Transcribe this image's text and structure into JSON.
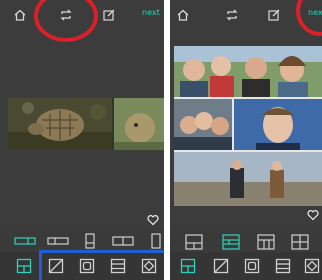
{
  "left_screen": {
    "toolbar": {
      "home_icon": "home-icon",
      "swap_icon": "swap-icon",
      "edit_icon": "edit-icon",
      "next_label": "next"
    },
    "selected_layout_index": 0,
    "selected_tab_index": 0
  },
  "right_screen": {
    "toolbar": {
      "home_icon": "home-icon",
      "swap_icon": "swap-icon",
      "edit_icon": "edit-icon",
      "next_label": "next"
    },
    "selected_layout_index": 1,
    "selected_tab_index": 0
  },
  "colors": {
    "accent": "#2fd3b8",
    "highlight_ring": "#d8212a",
    "highlight_box": "#1f5fd6",
    "selection": "#50c878"
  }
}
